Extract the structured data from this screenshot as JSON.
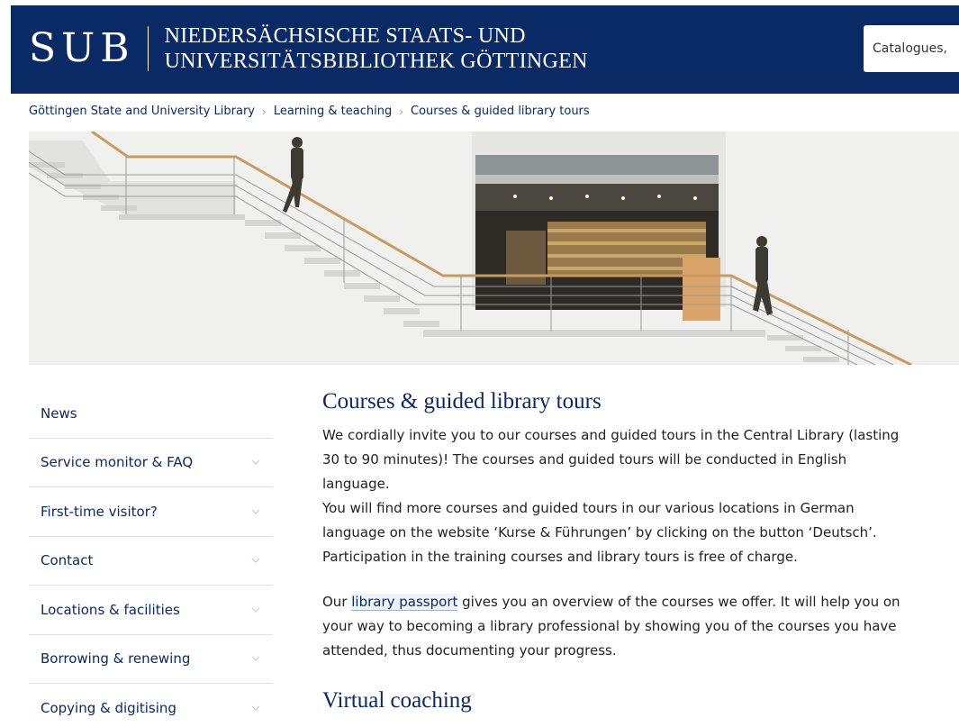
{
  "header": {
    "logo_text": "SUB",
    "institution_line1": "NIEDERSÄCHSISCHE STAATS- UND",
    "institution_line2": "UNIVERSITÄTSBIBLIOTHEK GÖTTINGEN",
    "search_placeholder": "Catalogues,",
    "bg_color": "#0a2a66"
  },
  "breadcrumb": [
    "Göttingen State and University Library",
    "Learning & teaching",
    "Courses & guided library tours"
  ],
  "sidebar": {
    "items": [
      {
        "label": "News",
        "has_chevron": false
      },
      {
        "label": "Service monitor & FAQ",
        "has_chevron": true
      },
      {
        "label": "First-time visitor?",
        "has_chevron": true
      },
      {
        "label": "Contact",
        "has_chevron": true
      },
      {
        "label": "Locations & facilities",
        "has_chevron": true
      },
      {
        "label": "Borrowing & renewing",
        "has_chevron": true
      },
      {
        "label": "Copying & digitising",
        "has_chevron": true
      }
    ]
  },
  "main": {
    "title": "Courses & guided library tours",
    "intro": "We cordially invite you to our courses and guided tours in the Central Library (lasting 30 to 90 minutes)! The courses and guided tours will be conducted in English language.",
    "german_info": "You will find more courses and guided tours in our various locations in German language on the website ‘Kurse & Führungen’ by clicking on the button ‘Deutsch’.",
    "free_info": "Participation in the training courses and library tours is free of charge.",
    "passport_pre": "Our ",
    "passport_link": "library passport",
    "passport_post": " gives you an overview of the courses we offer. It will help you on your way to becoming a library professional by showing you of the courses you have attended, thus documenting your progress.",
    "section2_title": "Virtual coaching"
  }
}
